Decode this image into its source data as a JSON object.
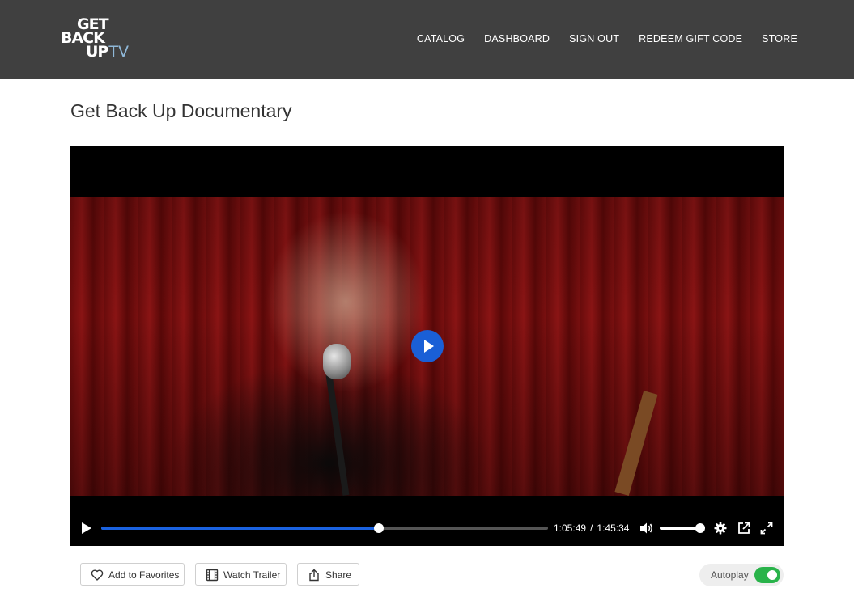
{
  "header": {
    "logo": {
      "line1": "GET",
      "line2": "BACK",
      "line3": "UP",
      "suffix": "TV"
    },
    "nav": [
      {
        "label": "CATALOG"
      },
      {
        "label": "DASHBOARD"
      },
      {
        "label": "SIGN OUT"
      },
      {
        "label": "REDEEM GIFT CODE"
      },
      {
        "label": "STORE"
      }
    ]
  },
  "page": {
    "title": "Get Back Up Documentary"
  },
  "player": {
    "current_time": "1:05:49",
    "separator": "/",
    "duration": "1:45:34",
    "progress_fraction": 0.622,
    "volume_fraction": 1.0,
    "accent_color": "#1a62e0",
    "icons": [
      "play-icon",
      "volume-icon",
      "settings-icon",
      "popout-icon",
      "fullscreen-icon"
    ]
  },
  "actions": {
    "favorites": {
      "label": "Add to Favorites",
      "icon": "heart-icon"
    },
    "trailer": {
      "label": "Watch Trailer",
      "icon": "film-icon"
    },
    "share": {
      "label": "Share",
      "icon": "share-icon"
    }
  },
  "autoplay": {
    "label": "Autoplay",
    "enabled": true,
    "color": "#29b34a"
  }
}
